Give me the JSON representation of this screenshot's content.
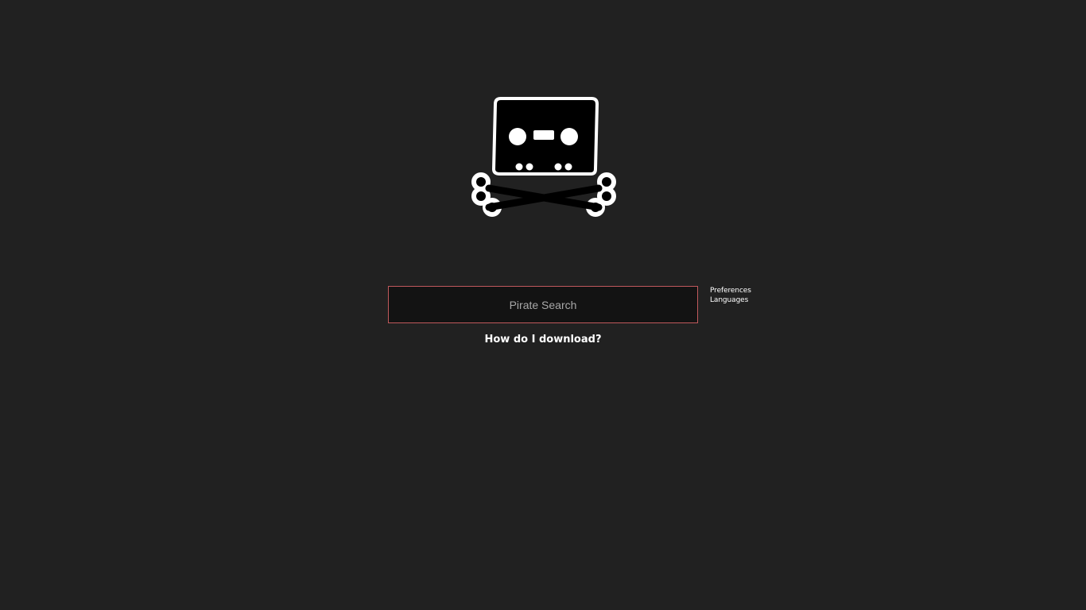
{
  "logo": {
    "icon": "cassette-skull-crossbones-icon",
    "colors": {
      "fill": "#000000",
      "outline": "#ffffff"
    }
  },
  "search": {
    "placeholder": "Pirate Search",
    "value": "",
    "border_color": "#c0595c"
  },
  "side_links": {
    "preferences": "Preferences",
    "languages": "Languages"
  },
  "help": {
    "download_link": "How do I download?"
  },
  "colors": {
    "background": "#212121",
    "search_background": "#131313",
    "text": "#ffffff"
  }
}
